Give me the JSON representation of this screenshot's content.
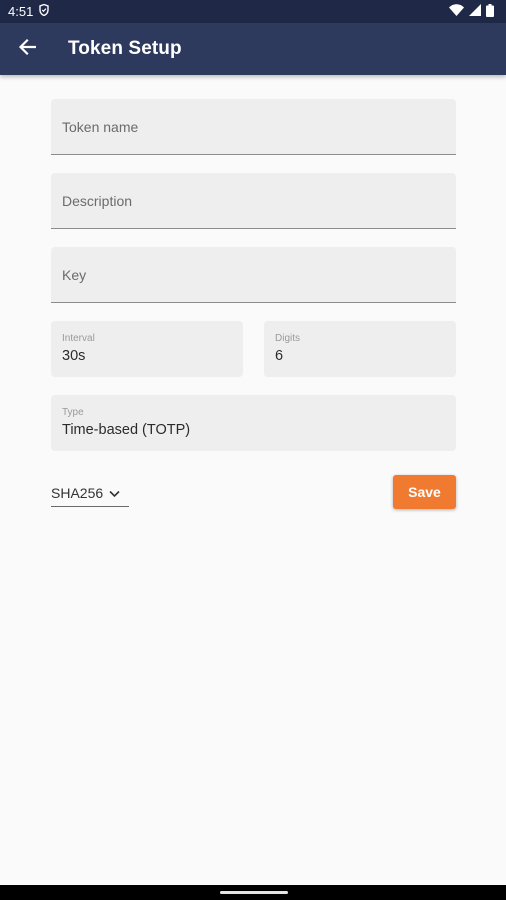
{
  "status_bar": {
    "time": "4:51"
  },
  "app_bar": {
    "title": "Token Setup"
  },
  "form": {
    "token_name": {
      "placeholder": "Token name",
      "value": ""
    },
    "description": {
      "placeholder": "Description",
      "value": ""
    },
    "key": {
      "placeholder": "Key",
      "value": ""
    },
    "interval": {
      "label": "Interval",
      "value": "30s"
    },
    "digits": {
      "label": "Digits",
      "value": "6"
    },
    "type": {
      "label": "Type",
      "value": "Time-based (TOTP)"
    },
    "algorithm": {
      "selected": "SHA256"
    },
    "save_label": "Save"
  },
  "colors": {
    "status_bar": "#1f2947",
    "app_bar": "#2d3a5e",
    "save_button": "#ef7a30",
    "field_bg": "#eeeeee"
  },
  "icons": [
    "shield-icon",
    "wifi-icon",
    "signal-icon",
    "battery-icon",
    "back-arrow-icon",
    "chevron-down-icon"
  ]
}
